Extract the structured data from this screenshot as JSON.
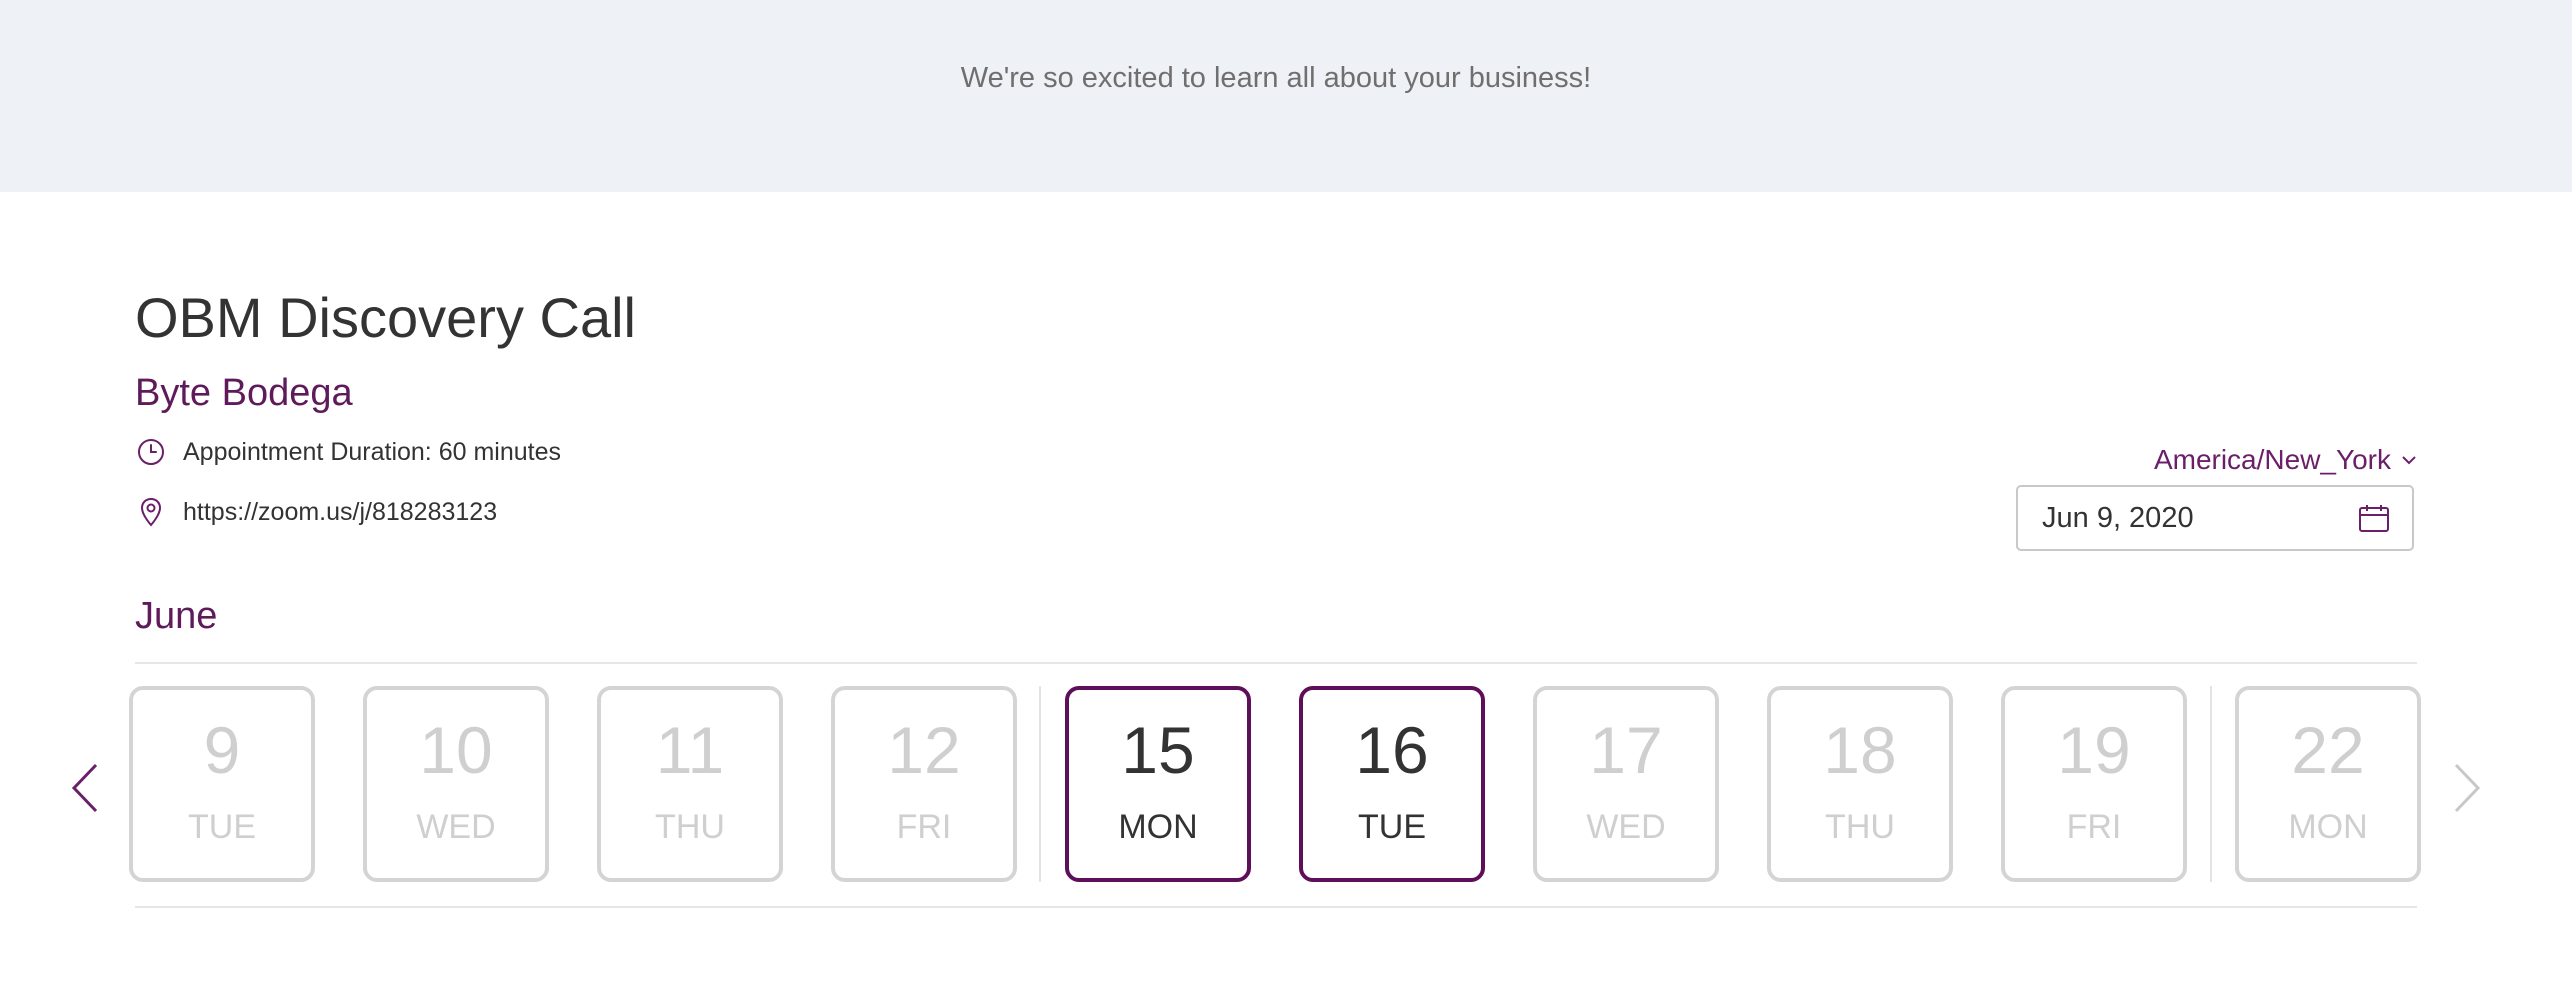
{
  "banner": {
    "text": "We're so excited to learn all about your business!"
  },
  "event": {
    "title": "OBM Discovery Call",
    "business": "Byte Bodega",
    "duration": "Appointment Duration: 60 minutes",
    "location": "https://zoom.us/j/818283123"
  },
  "timezone": {
    "label": "America/New_York"
  },
  "datepicker": {
    "value": "Jun 9, 2020"
  },
  "calendar": {
    "month": "June",
    "days": [
      {
        "num": "9",
        "dow": "TUE",
        "available": false
      },
      {
        "num": "10",
        "dow": "WED",
        "available": false
      },
      {
        "num": "11",
        "dow": "THU",
        "available": false
      },
      {
        "num": "12",
        "dow": "FRI",
        "available": false
      },
      {
        "num": "15",
        "dow": "MON",
        "available": true
      },
      {
        "num": "16",
        "dow": "TUE",
        "available": true
      },
      {
        "num": "17",
        "dow": "WED",
        "available": false
      },
      {
        "num": "18",
        "dow": "THU",
        "available": false
      },
      {
        "num": "19",
        "dow": "FRI",
        "available": false
      },
      {
        "num": "22",
        "dow": "MON",
        "available": false
      }
    ]
  },
  "icons": {
    "clock": "clock-icon",
    "location": "location-pin-icon",
    "calendar": "calendar-icon",
    "prev": "chevron-left-icon",
    "next": "chevron-right-icon",
    "dropdown": "chevron-down-icon"
  },
  "colors": {
    "accent": "#5e0f5a",
    "banner_bg": "#eef1f5",
    "disabled": "#d4d4d4"
  }
}
